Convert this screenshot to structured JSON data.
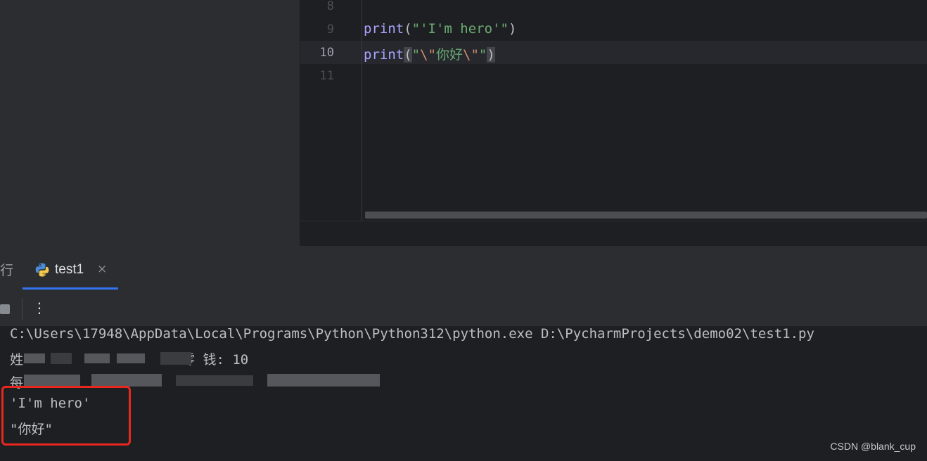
{
  "editor": {
    "lines": [
      {
        "number": "8",
        "code": ""
      },
      {
        "number": "9",
        "fn": "print",
        "open": "(",
        "str1": "\"'I'm hero'\"",
        "close": ")"
      },
      {
        "number": "10",
        "fn": "print",
        "open": "(",
        "q1": "\"",
        "esc1": "\\\"",
        "text": "你好",
        "esc2": "\\\"",
        "q2": "\"",
        "close": ")"
      },
      {
        "number": "11",
        "code": ""
      }
    ]
  },
  "run_panel": {
    "prev_tab_glyph": "行",
    "tab_label": "test1",
    "tab_close": "×",
    "more_glyph": "⋮"
  },
  "console": {
    "command": "C:\\Users\\17948\\AppData\\Local\\Programs\\Python\\Python312\\python.exe D:\\PycharmProjects\\demo02\\test1.py",
    "line2_start": "姓",
    "line2_end": "零 钱: 10",
    "line3_start": "每",
    "output1": "'I'm hero'",
    "output2": "\"你好\""
  },
  "watermark": "CSDN @blank_cup",
  "colors": {
    "accent": "#3574f0",
    "highlight": "#e8271f",
    "keyword_fn": "#a9a4ff",
    "string": "#6aab73",
    "escape": "#cf8e6d"
  }
}
